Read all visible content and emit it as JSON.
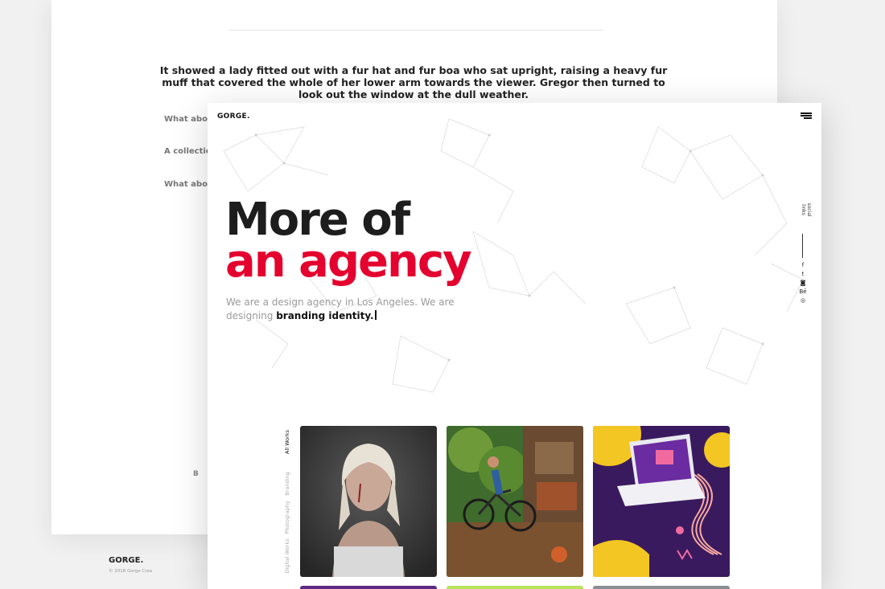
{
  "back_page": {
    "quote": "It showed a lady fitted out with a fur hat and fur boa who sat upright, raising a heavy fur muff that covered the whole of her lower arm towards the viewer. Gregor then turned to look out the window at the dull weather.",
    "questions": [
      "What abou",
      "A collection",
      "What abou"
    ],
    "partial_text": "B R",
    "footer_logo": "GORGE.",
    "footer_copy": "© 2018 Gorge Crea"
  },
  "header": {
    "logo": "GORGE."
  },
  "hero": {
    "line1": "More of",
    "line2": "an agency",
    "subtitle_start": "We are a design agency in Los Angeles. We are",
    "subtitle_mid": "designing",
    "subtitle_bold": "branding identity.",
    "accent_color": "#e4032e"
  },
  "social": {
    "label": "social links",
    "icons": [
      {
        "name": "facebook-icon",
        "glyph": "f"
      },
      {
        "name": "twitter-icon",
        "glyph": "t"
      },
      {
        "name": "instagram-icon",
        "glyph": "◙"
      },
      {
        "name": "behance-icon",
        "glyph": "Bē"
      },
      {
        "name": "dribbble-icon",
        "glyph": "◎"
      }
    ]
  },
  "portfolio": {
    "filters": [
      "All Works",
      "Branding",
      "Photography",
      "Digital Works"
    ],
    "active_filter": "All Works",
    "tiles": [
      {
        "name": "portrait-photo-tile",
        "subject": "portrait"
      },
      {
        "name": "cyclist-illustration-tile",
        "subject": "cyclist"
      },
      {
        "name": "social-media-laptop-tile",
        "subject": "laptop"
      },
      {
        "name": "purple-tile",
        "subject": "purple"
      },
      {
        "name": "green-tile",
        "subject": "green"
      },
      {
        "name": "grey-tile",
        "subject": "grey"
      }
    ]
  }
}
